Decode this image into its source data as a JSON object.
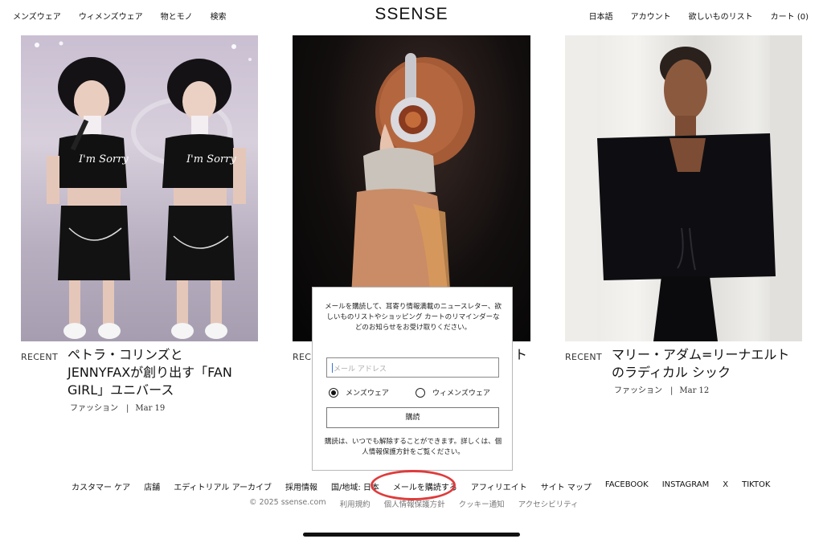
{
  "header": {
    "nav_left": [
      "メンズウェア",
      "ウィメンズウェア",
      "物とモノ",
      "検索"
    ],
    "logo": "SSENSE",
    "nav_right": [
      "日本語",
      "アカウント",
      "欲しいものリスト",
      "カート (0)"
    ]
  },
  "cards": [
    {
      "recent": "RECENT",
      "title_lines": [
        "ペトラ・コリンズと",
        "JENNYFAXが創り出す「FAN",
        "GIRL」ユニバース"
      ],
      "category": "ファッション",
      "date": "Mar 19",
      "image_text": [
        "I'm Sorry",
        "I'm Sorry"
      ]
    },
    {
      "recent": "REC",
      "title_fragment": "ト"
    },
    {
      "recent": "RECENT",
      "title_lines": [
        "マリー・アダム=リーナエルト",
        "のラディカル シック"
      ],
      "category": "ファッション",
      "date": "Mar 12"
    }
  ],
  "newsletter_modal": {
    "message": "メールを購読して、耳寄り情報満載のニュースレター、欲しいものリストやショッピング カートのリマインダーなどのお知らせをお受け取りください。",
    "email_placeholder": "メール アドレス",
    "radio_options": [
      "メンズウェア",
      "ウィメンズウェア"
    ],
    "selected_option": "メンズウェア",
    "submit_label": "購読",
    "footer_text": "購読は、いつでも解除することができます。詳しくは、個人情報保護方針をご覧ください。"
  },
  "footer": {
    "links": [
      "カスタマー ケア",
      "店舗",
      "エディトリアル アーカイブ",
      "採用情報",
      "国/地域: 日本",
      "メールを購読する",
      "アフィリエイト",
      "サイト マップ",
      "FACEBOOK",
      "INSTAGRAM",
      "X",
      "TIKTOK"
    ],
    "legal": [
      "© 2025 ssense.com",
      "利用規約",
      "個人情報保護方針",
      "クッキー通知",
      "アクセシビリティ"
    ]
  },
  "colors": {
    "highlight": "#e03b3b",
    "text": "#111111",
    "muted": "#777777"
  }
}
